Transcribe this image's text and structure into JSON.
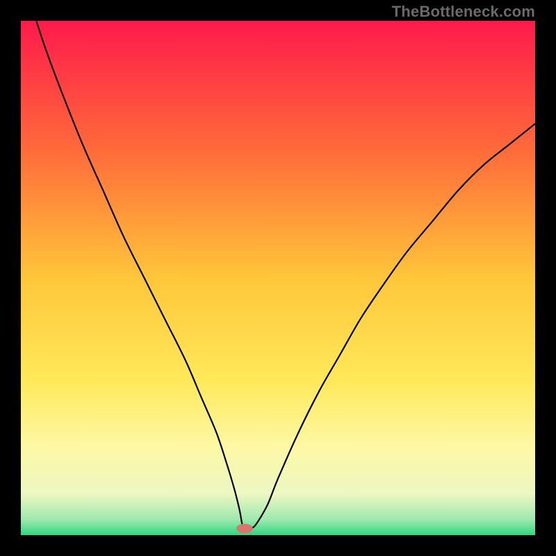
{
  "watermark": "TheBottleneck.com",
  "chart_data": {
    "type": "line",
    "title": "",
    "xlabel": "",
    "ylabel": "",
    "xlim": [
      0,
      100
    ],
    "ylim": [
      0,
      100
    ],
    "grid": false,
    "legend": false,
    "background_gradient": {
      "stops": [
        {
          "offset": 0.0,
          "color": "#ff1a4b"
        },
        {
          "offset": 0.25,
          "color": "#ff6a3a"
        },
        {
          "offset": 0.5,
          "color": "#ffc63a"
        },
        {
          "offset": 0.7,
          "color": "#ffe95a"
        },
        {
          "offset": 0.83,
          "color": "#fdf8a6"
        },
        {
          "offset": 0.92,
          "color": "#ecf7c2"
        },
        {
          "offset": 0.97,
          "color": "#9de9af"
        },
        {
          "offset": 1.0,
          "color": "#2fd680"
        }
      ]
    },
    "series": [
      {
        "name": "bottleneck-curve",
        "color": "#000000",
        "x": [
          3,
          5,
          8,
          12,
          16,
          20,
          24,
          28,
          32,
          35,
          38,
          40,
          41.5,
          42.5,
          43.2,
          44,
          45,
          46,
          48,
          50,
          54,
          58,
          62,
          66,
          70,
          75,
          80,
          85,
          90,
          95,
          100
        ],
        "y": [
          100,
          94,
          86,
          76,
          67,
          58,
          50,
          42,
          34,
          27,
          20,
          14,
          9,
          5,
          1.5,
          1.2,
          1.4,
          2.5,
          6,
          11,
          20,
          28,
          35,
          42,
          48,
          55,
          61,
          67,
          72,
          76,
          80
        ]
      }
    ],
    "marker": {
      "name": "optimal-point",
      "x": 43.5,
      "y": 1.3,
      "rx": 1.6,
      "ry": 0.9,
      "color": "#d8766d"
    }
  }
}
